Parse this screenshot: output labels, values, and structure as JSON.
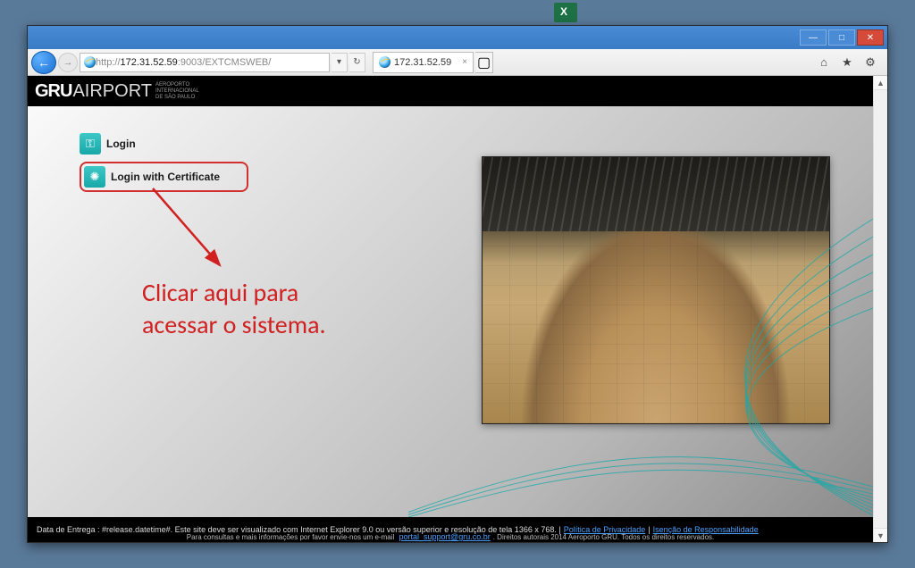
{
  "browser": {
    "url_prefix": "http://",
    "url_host": "172.31.52.59",
    "url_port_path": ":9003/EXTCMSWEB/",
    "tab_title": "172.31.52.59",
    "dropdown_glyph": "▾",
    "refresh_glyph": "↻",
    "back_glyph": "←",
    "fwd_glyph": "→",
    "newtab_glyph": "▢",
    "close_glyph": "×",
    "home_glyph": "⌂",
    "star_glyph": "★",
    "gear_glyph": "⚙",
    "min_glyph": "—",
    "max_glyph": "□",
    "winclose_glyph": "✕",
    "scroll_up": "▲",
    "scroll_down": "▼"
  },
  "logo": {
    "gru": "GRU",
    "airport": "AIRPORT",
    "sub1": "Aeroporto",
    "sub2": "Internacional",
    "sub3": "de São Paulo"
  },
  "login": {
    "standard": "Login",
    "certificate": "Login with Certificate",
    "key_glyph": "⚿",
    "gear_glyph": "✺"
  },
  "annotation": {
    "line1": "Clicar aqui para",
    "line2": "acessar o sistema."
  },
  "footer": {
    "delivery_prefix": "Data de Entrega : ",
    "delivery_token": "#release.datetime#",
    "req_text": ". Este site deve ser visualizado com Internet Explorer 9.0 ou versão superior e resolução de tela 1366 x 768.  |  ",
    "privacy": "Política de Privacidade",
    "sep": "  |  ",
    "disclaimer": "Isenção de Responsabilidade",
    "line2a": "Para consultas e mais informações por favor envie-nos um e-mail ",
    "support_email": "portal_support@gru.co.br",
    "line2b": ". Direitos autorais 2014 Aeroporto GRU. Todos os direitos reservados."
  }
}
